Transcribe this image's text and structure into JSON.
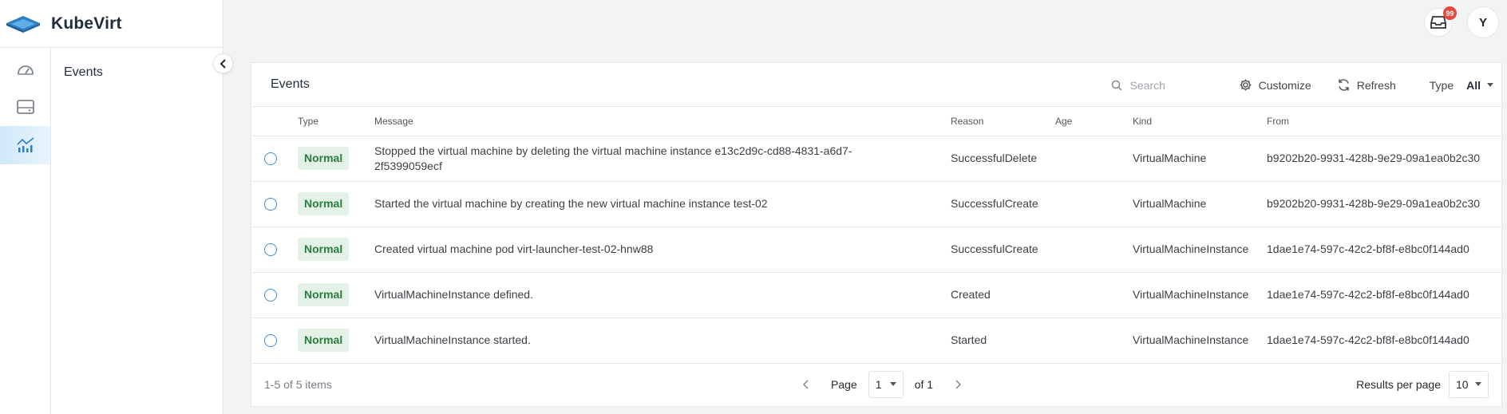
{
  "app": {
    "title": "KubeVirt"
  },
  "header": {
    "notifications_count": "99",
    "avatar_initial": "Y"
  },
  "sidebar": {
    "section_label": "Events",
    "rail_items": [
      "dashboard-icon",
      "storage-icon",
      "monitoring-icon"
    ]
  },
  "toolbar": {
    "title": "Events",
    "search_placeholder": "Search",
    "customize_label": "Customize",
    "refresh_label": "Refresh",
    "type_label": "Type",
    "type_value": "All"
  },
  "table": {
    "columns": [
      "Type",
      "Message",
      "Reason",
      "Age",
      "Kind",
      "From"
    ],
    "rows": [
      {
        "type": "Normal",
        "message": "Stopped the virtual machine by deleting the virtual machine instance e13c2d9c-cd88-4831-a6d7-2f5399059ecf",
        "reason": "SuccessfulDelete",
        "age": "",
        "kind": "VirtualMachine",
        "from": "b9202b20-9931-428b-9e29-09a1ea0b2c30"
      },
      {
        "type": "Normal",
        "message": "Started the virtual machine by creating the new virtual machine instance test-02",
        "reason": "SuccessfulCreate",
        "age": "",
        "kind": "VirtualMachine",
        "from": "b9202b20-9931-428b-9e29-09a1ea0b2c30"
      },
      {
        "type": "Normal",
        "message": "Created virtual machine pod virt-launcher-test-02-hnw88",
        "reason": "SuccessfulCreate",
        "age": "",
        "kind": "VirtualMachineInstance",
        "from": "1dae1e74-597c-42c2-bf8f-e8bc0f144ad0"
      },
      {
        "type": "Normal",
        "message": "VirtualMachineInstance defined.",
        "reason": "Created",
        "age": "",
        "kind": "VirtualMachineInstance",
        "from": "1dae1e74-597c-42c2-bf8f-e8bc0f144ad0"
      },
      {
        "type": "Normal",
        "message": "VirtualMachineInstance started.",
        "reason": "Started",
        "age": "",
        "kind": "VirtualMachineInstance",
        "from": "1dae1e74-597c-42c2-bf8f-e8bc0f144ad0"
      }
    ]
  },
  "footer": {
    "count_text": "1-5 of 5 items",
    "page_label": "Page",
    "page_value": "1",
    "page_total": "of 1",
    "rpp_label": "Results per page",
    "rpp_value": "10"
  },
  "colors": {
    "accent": "#3c8fd6",
    "tag_bg": "#e3f1e6",
    "tag_text": "#2a7d3f",
    "badge": "#e5483c"
  }
}
